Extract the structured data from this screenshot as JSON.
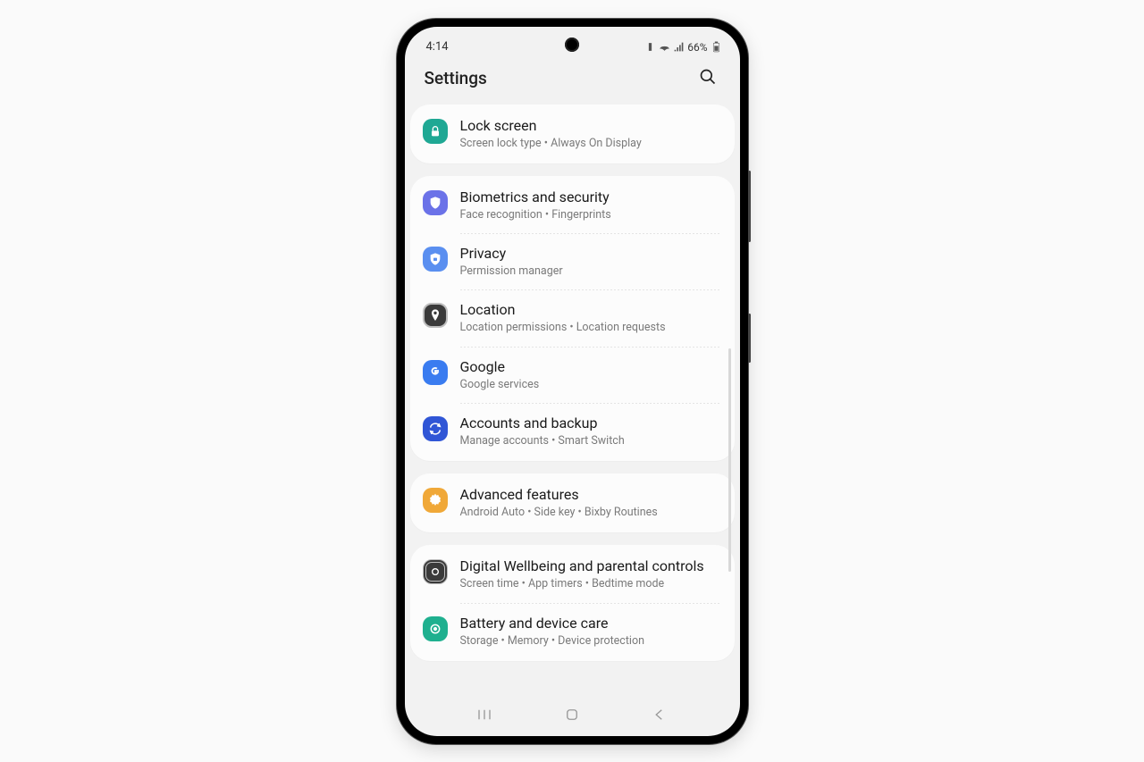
{
  "status": {
    "time": "4:14",
    "battery_text": "66%"
  },
  "header": {
    "title": "Settings"
  },
  "groups": [
    {
      "items": [
        {
          "id": "lock-screen",
          "title": "Lock screen",
          "subtitle": "Screen lock type  •  Always On Display",
          "icon": "lock",
          "color": "bg-teal"
        }
      ]
    },
    {
      "items": [
        {
          "id": "biometrics",
          "title": "Biometrics and security",
          "subtitle": "Face recognition  •  Fingerprints",
          "icon": "shield",
          "color": "bg-indigo"
        },
        {
          "id": "privacy",
          "title": "Privacy",
          "subtitle": "Permission manager",
          "icon": "shield-lock",
          "color": "bg-blue"
        },
        {
          "id": "location",
          "title": "Location",
          "subtitle": "Location permissions  •  Location requests",
          "icon": "pin",
          "color": "bg-loc"
        },
        {
          "id": "google",
          "title": "Google",
          "subtitle": "Google services",
          "icon": "g",
          "color": "bg-google"
        },
        {
          "id": "accounts",
          "title": "Accounts and backup",
          "subtitle": "Manage accounts  •  Smart Switch",
          "icon": "sync",
          "color": "bg-sync"
        }
      ]
    },
    {
      "items": [
        {
          "id": "advanced",
          "title": "Advanced features",
          "subtitle": "Android Auto  •  Side key  •  Bixby Routines",
          "icon": "gear",
          "color": "bg-orange"
        }
      ]
    },
    {
      "items": [
        {
          "id": "wellbeing",
          "title": "Digital Wellbeing and parental controls",
          "subtitle": "Screen time  •  App timers  •  Bedtime mode",
          "icon": "circle",
          "color": "bg-well"
        },
        {
          "id": "battery",
          "title": "Battery and device care",
          "subtitle": "Storage  •  Memory  •  Device protection",
          "icon": "care",
          "color": "bg-battery"
        }
      ]
    }
  ]
}
